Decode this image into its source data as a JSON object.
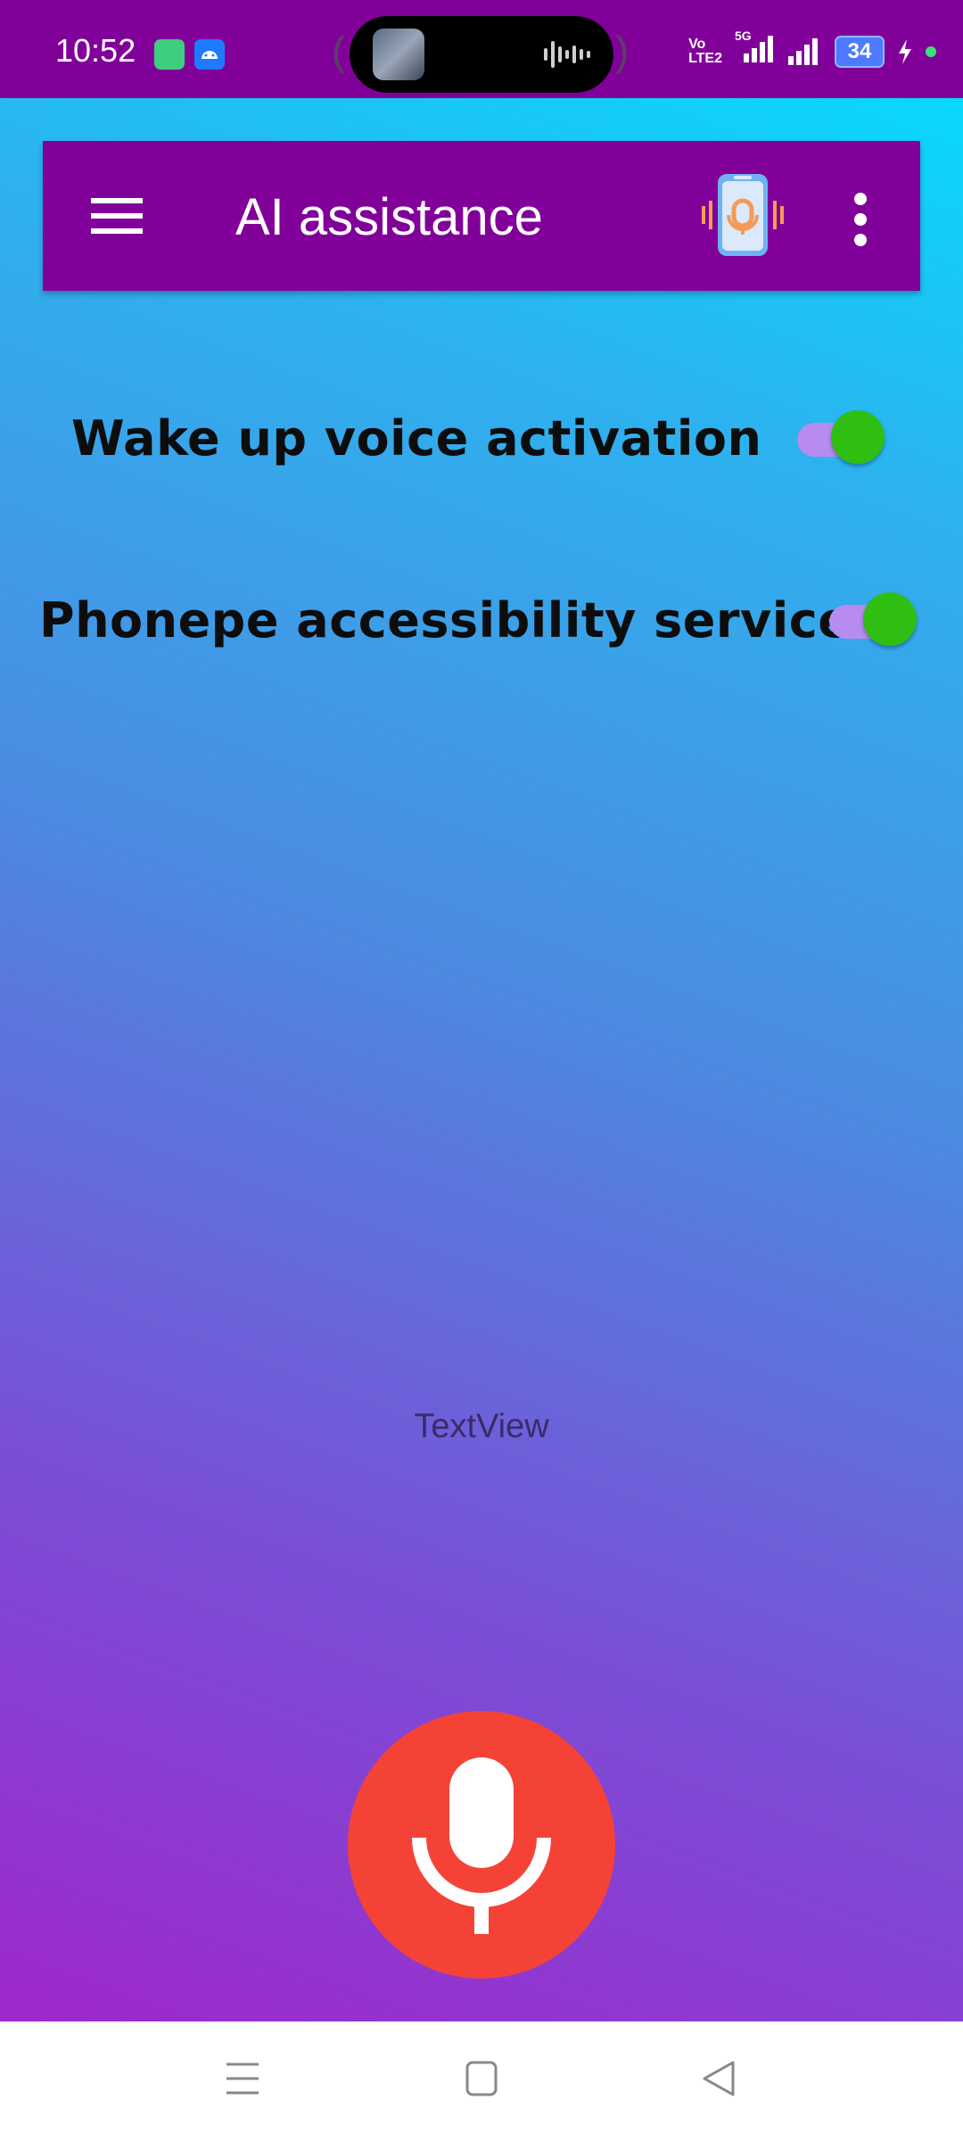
{
  "status_bar": {
    "time": "10:52",
    "network_label_top": "Vo",
    "network_label_bottom": "LTE2",
    "network_type": "5G",
    "battery_level": "34",
    "colors": {
      "background": "#82009a",
      "battery": "#4d7bff",
      "dot": "#3ee07a"
    }
  },
  "app_bar": {
    "title": "AI assistance",
    "icons": [
      "menu-icon",
      "voice-assistant-phone-icon",
      "more-vert-icon"
    ],
    "background": "#82009a"
  },
  "settings": [
    {
      "label": "Wake up voice activation",
      "enabled": true
    },
    {
      "label": "Phonepe accessibility service",
      "enabled": true
    }
  ],
  "content": {
    "text_view": "TextView"
  },
  "mic_button": {
    "icon": "microphone-icon",
    "color": "#f44336"
  },
  "nav_bar": {
    "icons": [
      "recents-icon",
      "home-icon",
      "back-icon"
    ]
  }
}
